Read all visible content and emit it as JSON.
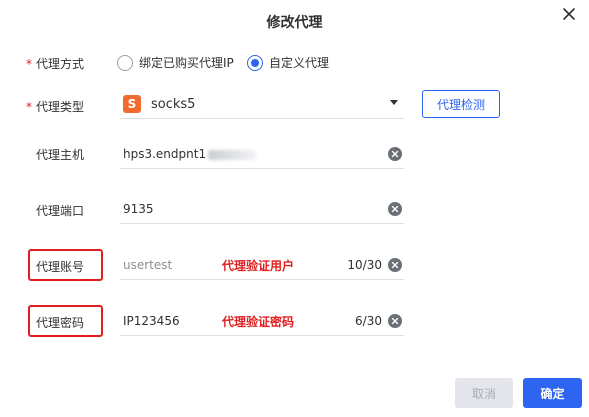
{
  "dialog": {
    "title": "修改代理",
    "close_icon": "close-icon"
  },
  "form": {
    "method": {
      "required_mark": "*",
      "label": "代理方式",
      "options": [
        {
          "label": "绑定已购买代理IP",
          "selected": false
        },
        {
          "label": "自定义代理",
          "selected": true
        }
      ]
    },
    "type": {
      "required_mark": "*",
      "label": "代理类型",
      "badge": "S",
      "value": "socks5",
      "check_button": "代理检测"
    },
    "host": {
      "label": "代理主机",
      "value": "hps3.endpnt1"
    },
    "port": {
      "label": "代理端口",
      "value": "9135"
    },
    "account": {
      "label": "代理账号",
      "placeholder": "usertest",
      "annotation": "代理验证用户",
      "counter": "10/30"
    },
    "password": {
      "label": "代理密码",
      "value": "IP123456",
      "annotation": "代理验证密码",
      "counter": "6/30"
    }
  },
  "footer": {
    "cancel_label": "取消",
    "confirm_label": "确定"
  },
  "colors": {
    "primary": "#2d64f0",
    "required": "#e02020",
    "annotation": "#e02020",
    "badge": "#f26b2e",
    "disabled_bg": "#e4e6eb"
  }
}
